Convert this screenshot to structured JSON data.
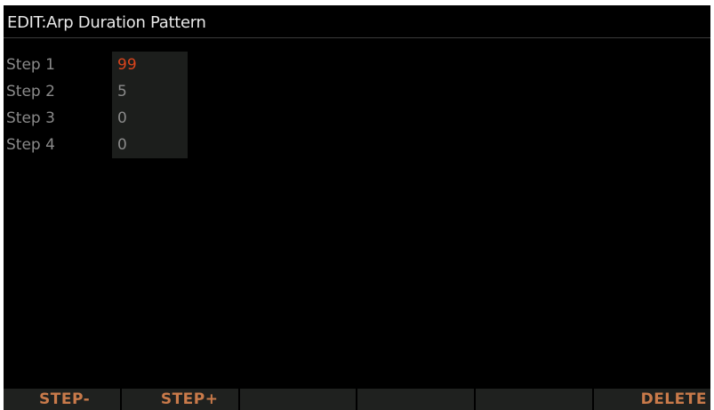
{
  "title": "EDIT:Arp Duration Pattern",
  "steps": [
    {
      "label": "Step 1",
      "value": "99",
      "selected": true
    },
    {
      "label": "Step 2",
      "value": "5",
      "selected": false
    },
    {
      "label": "Step 3",
      "value": "0",
      "selected": false
    },
    {
      "label": "Step 4",
      "value": "0",
      "selected": false
    }
  ],
  "softkeys": [
    "STEP-",
    "STEP+",
    "",
    "",
    "",
    "DELETE"
  ],
  "colors": {
    "background": "#000000",
    "title_text": "#e8e8e8",
    "label_text": "#8a8a8a",
    "selected_value": "#d8441c",
    "value_cell": "#1c1e1c",
    "softkey_bg": "#1f211f",
    "softkey_text": "#c97a4a"
  }
}
